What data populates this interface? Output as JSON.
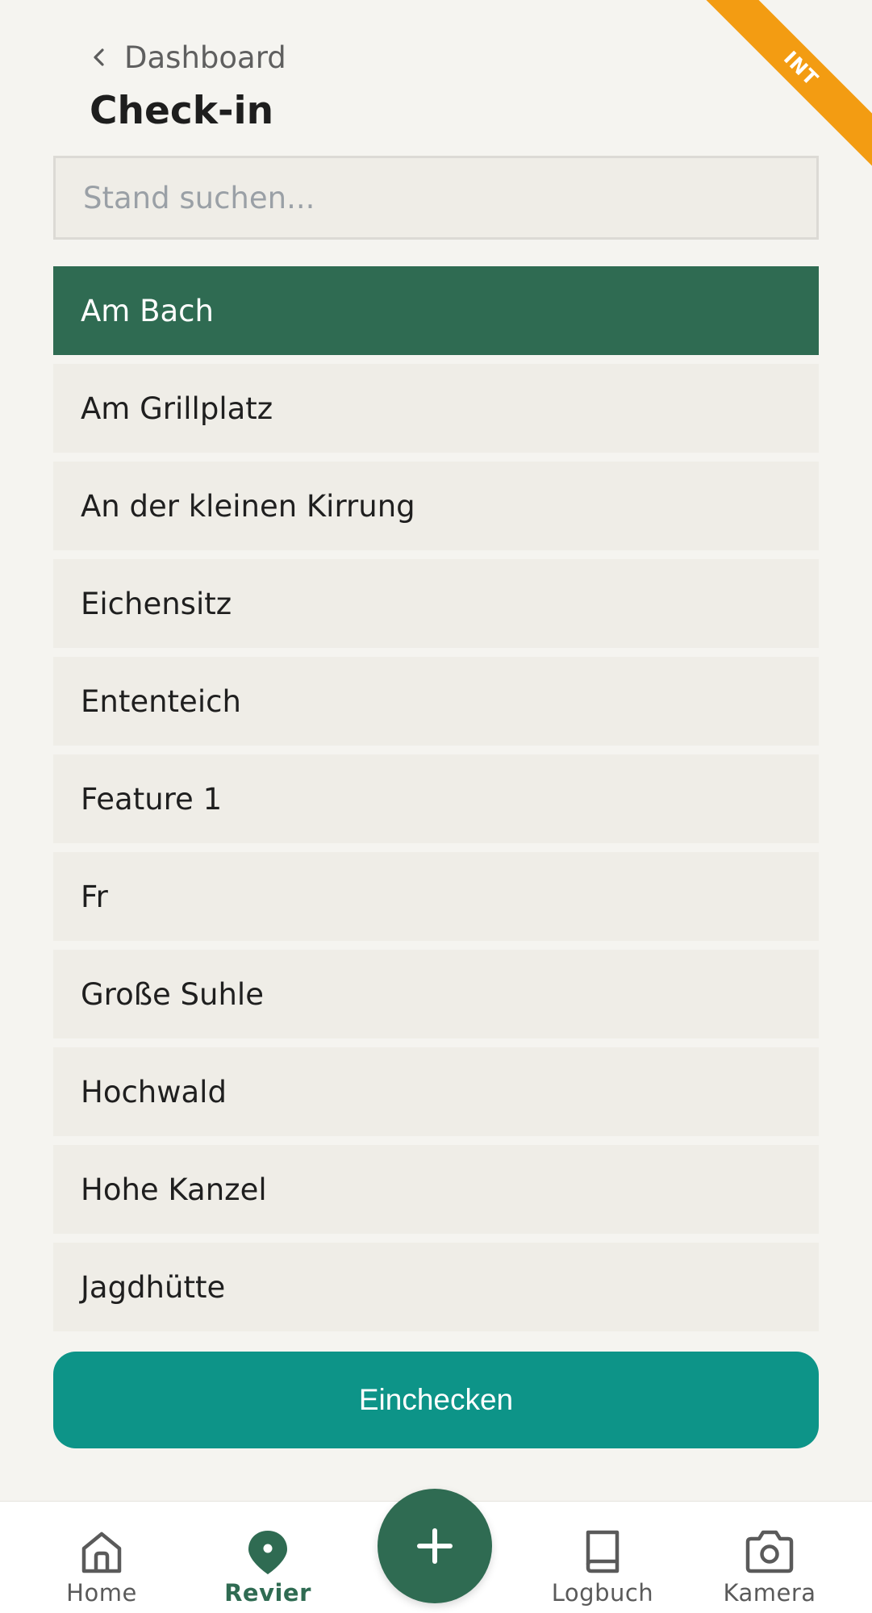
{
  "env_badge": "INT",
  "header": {
    "back_label": "Dashboard",
    "title": "Check-in"
  },
  "search": {
    "placeholder": "Stand suchen...",
    "value": ""
  },
  "stands": [
    {
      "label": "Am Bach",
      "selected": true
    },
    {
      "label": "Am Grillplatz",
      "selected": false
    },
    {
      "label": "An der kleinen Kirrung",
      "selected": false
    },
    {
      "label": "Eichensitz",
      "selected": false
    },
    {
      "label": "Ententeich",
      "selected": false
    },
    {
      "label": "Feature 1",
      "selected": false
    },
    {
      "label": "Fr",
      "selected": false
    },
    {
      "label": "Große Suhle",
      "selected": false
    },
    {
      "label": "Hochwald",
      "selected": false
    },
    {
      "label": "Hohe Kanzel",
      "selected": false
    },
    {
      "label": "Jagdhütte",
      "selected": false
    }
  ],
  "checkin_button": "Einchecken",
  "nav": {
    "home": "Home",
    "revier": "Revier",
    "logbuch": "Logbuch",
    "kamera": "Kamera",
    "active": "revier"
  },
  "colors": {
    "primary_green": "#2f6b52",
    "teal_button": "#0d9488",
    "badge_orange": "#f39c12"
  },
  "icons": {
    "back": "chevron-left-icon",
    "home": "home-icon",
    "revier": "map-pin-icon",
    "add": "plus-icon",
    "logbuch": "book-icon",
    "kamera": "camera-icon"
  }
}
